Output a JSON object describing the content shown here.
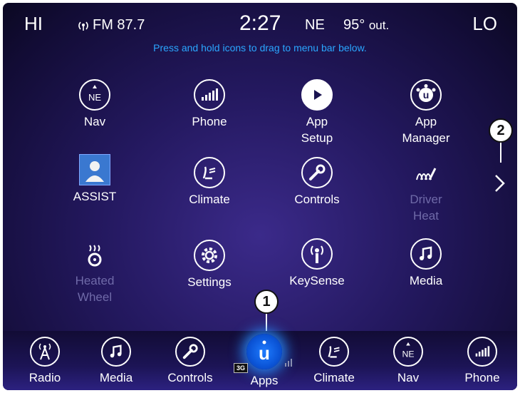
{
  "status_bar": {
    "hi_label": "HI",
    "lo_label": "LO",
    "radio_icon": "radio-signal-icon",
    "radio_station": "FM 87.7",
    "time": "2:27",
    "compass": "NE",
    "outside_temp": "95°",
    "outside_temp_suffix": "out."
  },
  "hint_text": "Press and hold icons to drag to menu bar below.",
  "apps": [
    {
      "label": "Nav",
      "icon": "nav-compass-icon"
    },
    {
      "label": "Phone",
      "icon": "phone-signal-icon"
    },
    {
      "label": "App\nSetup",
      "icon": "app-setup-icon"
    },
    {
      "label": "App\nManager",
      "icon": "app-manager-icon"
    },
    {
      "label": "ASSIST",
      "icon": "assist-icon"
    },
    {
      "label": "Climate",
      "icon": "climate-icon"
    },
    {
      "label": "Controls",
      "icon": "wrench-icon"
    },
    {
      "label": "Driver\nHeat",
      "icon": "seat-heat-icon",
      "disabled": true
    },
    {
      "label": "Heated\nWheel",
      "icon": "heated-wheel-icon",
      "disabled": true
    },
    {
      "label": "Settings",
      "icon": "gear-icon"
    },
    {
      "label": "KeySense",
      "icon": "keysense-icon"
    },
    {
      "label": "Media",
      "icon": "music-note-icon"
    }
  ],
  "dock": [
    {
      "label": "Radio",
      "icon": "radio-tower-icon"
    },
    {
      "label": "Media",
      "icon": "music-note-icon"
    },
    {
      "label": "Controls",
      "icon": "wrench-icon"
    },
    {
      "label": "Apps",
      "icon": "uconnect-apps-icon",
      "active": true
    },
    {
      "label": "Climate",
      "icon": "climate-icon"
    },
    {
      "label": "Nav",
      "icon": "nav-compass-icon"
    },
    {
      "label": "Phone",
      "icon": "phone-signal-icon"
    }
  ],
  "badges": {
    "network": "3G"
  },
  "callouts": [
    "1",
    "2"
  ],
  "compass_letters": "NE",
  "uconnect_letter": "u",
  "colors": {
    "hint": "#2aa6ff",
    "disabled": "#6f6aa8",
    "apps_glow": "#1e7bff"
  }
}
